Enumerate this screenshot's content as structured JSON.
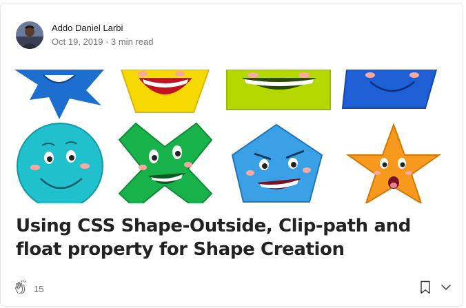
{
  "author": {
    "name": "Addo Daniel Larbi",
    "date": "Oct 19, 2019",
    "separator": " · ",
    "read_time": "3 min read"
  },
  "article": {
    "title": "Using CSS Shape-Outside, Clip-path and float property for Shape Creation"
  },
  "stats": {
    "claps": "15"
  },
  "icons": {
    "avatar": "author-avatar",
    "clap": "clap-icon",
    "bookmark": "bookmark-icon",
    "more": "chevron-down-icon"
  },
  "colors": {
    "blue_star": "#1c6fd1",
    "yellow_shape": "#f5d900",
    "green_shape": "#b4d800",
    "blue_shape": "#1e5fd6",
    "cyan_circle": "#20c0cc",
    "green_cross": "#18b24a",
    "blue_pentagon": "#3aa0e6",
    "orange_star": "#f7991c"
  }
}
